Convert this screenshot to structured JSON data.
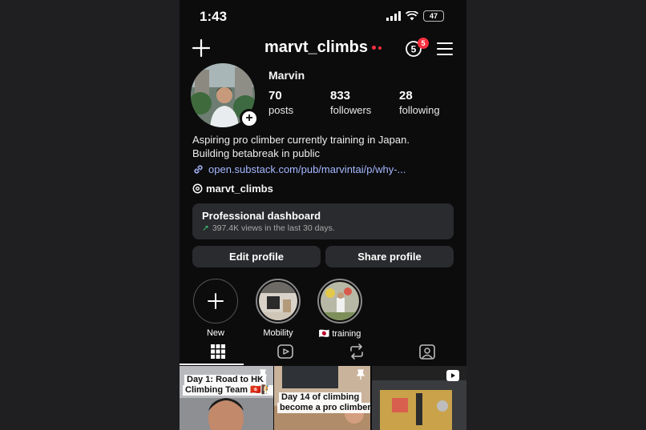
{
  "status_bar": {
    "time": "1:43",
    "battery": "47"
  },
  "header": {
    "username": "marvt_climbs",
    "notifications": "5"
  },
  "profile": {
    "name": "Marvin",
    "stats": [
      {
        "value": "70",
        "label": "posts"
      },
      {
        "value": "833",
        "label": "followers"
      },
      {
        "value": "28",
        "label": "following"
      }
    ],
    "bio_line1": "Aspiring pro climber currently training in Japan.",
    "bio_line2": "Building betabreak in public",
    "link": "open.substack.com/pub/marvintai/p/why-...",
    "threads_handle": "marvt_climbs"
  },
  "dashboard": {
    "title": "Professional dashboard",
    "subtitle": "397.4K views in the last 30 days."
  },
  "buttons": {
    "edit": "Edit profile",
    "share": "Share profile"
  },
  "highlights": [
    {
      "label": "New"
    },
    {
      "label": "Mobility"
    },
    {
      "label": "🇯🇵 training"
    }
  ],
  "tabs": [
    "grid-icon",
    "reels-icon",
    "reposts-icon",
    "tagged-icon"
  ],
  "posts": [
    {
      "caption_line1": "Day 1: Road to HK",
      "caption_line2": "Climbing Team 🇭🇰🧗"
    },
    {
      "caption_line1": "Day 14 of climbing",
      "caption_line2": "become a pro climber"
    },
    {
      "caption_line1": "",
      "caption_line2": ""
    }
  ]
}
